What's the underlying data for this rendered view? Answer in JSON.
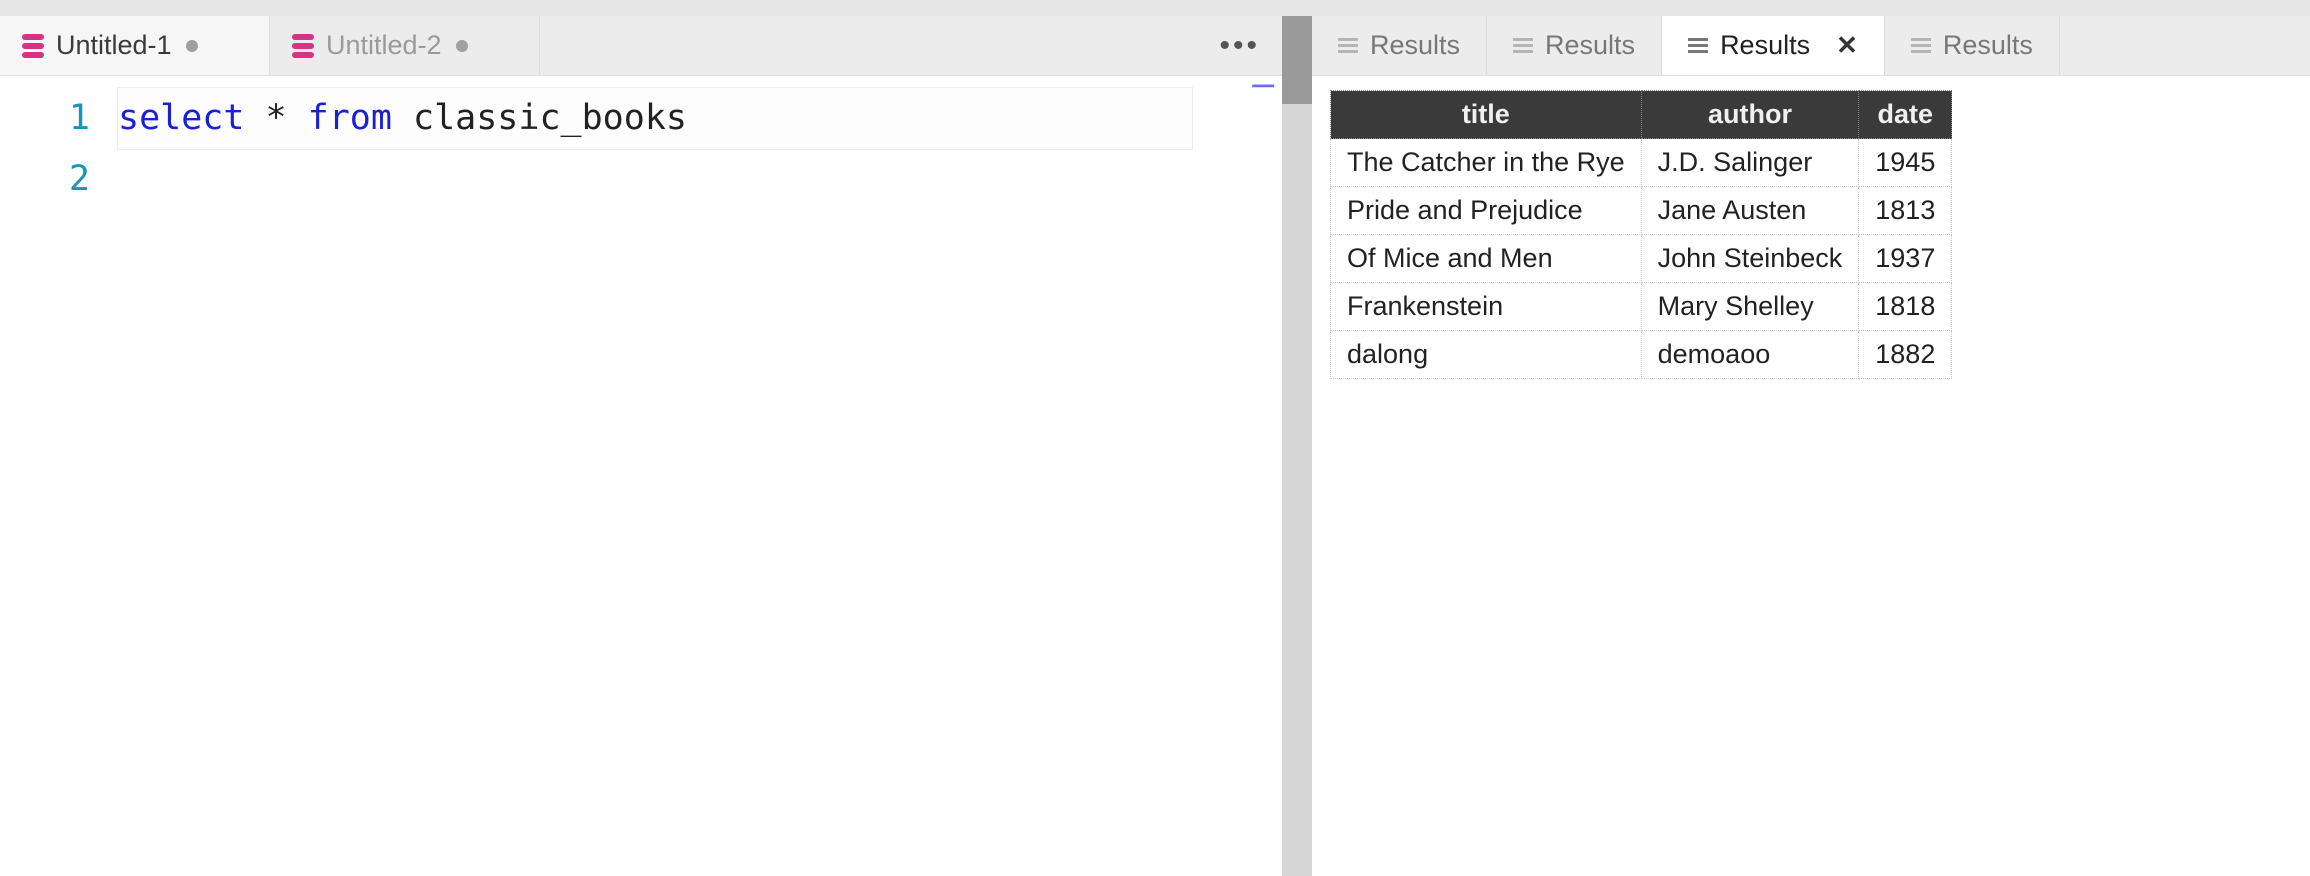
{
  "editor_tabs": [
    {
      "label": "Untitled-1",
      "active": true,
      "dirty": true
    },
    {
      "label": "Untitled-2",
      "active": false,
      "dirty": true
    }
  ],
  "overflow_glyph": "•••",
  "code": {
    "line_numbers": [
      "1",
      "2"
    ],
    "line1": "",
    "line2": {
      "kw1": "select",
      "star": " * ",
      "kw2": "from",
      "rest": " classic_books"
    }
  },
  "result_tabs": [
    {
      "label": "Results",
      "active": false,
      "closable": false
    },
    {
      "label": "Results",
      "active": false,
      "closable": false
    },
    {
      "label": "Results",
      "active": true,
      "closable": true
    },
    {
      "label": "Results",
      "active": false,
      "closable": false
    }
  ],
  "table": {
    "headers": [
      "title",
      "author",
      "date"
    ],
    "rows": [
      [
        "The Catcher in the Rye",
        "J.D. Salinger",
        "1945"
      ],
      [
        "Pride and Prejudice",
        "Jane Austen",
        "1813"
      ],
      [
        "Of Mice and Men",
        "John Steinbeck",
        "1937"
      ],
      [
        "Frankenstein",
        "Mary Shelley",
        "1818"
      ],
      [
        "dalong",
        "demoaoo",
        "1882"
      ]
    ]
  }
}
